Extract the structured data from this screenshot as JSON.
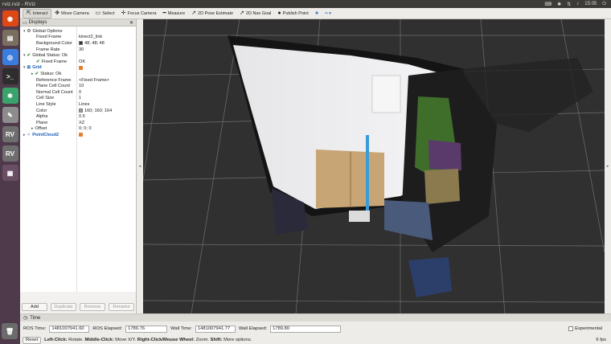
{
  "window": {
    "title": "rviz.rviz - RViz",
    "clock": "15:05"
  },
  "launcher": {
    "items": [
      {
        "name": "ubuntu-dash",
        "glyph": "◉",
        "color": "#dd4814"
      },
      {
        "name": "files",
        "glyph": "▤",
        "color": "#7a6f5f"
      },
      {
        "name": "chrome",
        "glyph": "◎",
        "color": "#3b7ddd"
      },
      {
        "name": "terminal",
        "glyph": ">_",
        "color": "#2d2d2d"
      },
      {
        "name": "robot-app",
        "glyph": "✱",
        "color": "#3aa36b"
      },
      {
        "name": "text-editor",
        "glyph": "✎",
        "color": "#8c8c8c"
      },
      {
        "name": "rviz-1",
        "glyph": "RV",
        "color": "#6e6e6e"
      },
      {
        "name": "rviz-2",
        "glyph": "RV",
        "color": "#6e6e6e"
      },
      {
        "name": "workspace",
        "glyph": "▦",
        "color": "#6a4f64"
      }
    ],
    "trash_glyph": "🗑"
  },
  "toolbar": {
    "tools": [
      {
        "label": "Interact",
        "icon": "cursor-icon",
        "glyph": "⇱",
        "active": true
      },
      {
        "label": "Move Camera",
        "icon": "move-camera-icon",
        "glyph": "✥",
        "active": false
      },
      {
        "label": "Select",
        "icon": "select-icon",
        "glyph": "▭",
        "active": false
      },
      {
        "label": "Focus Camera",
        "icon": "focus-camera-icon",
        "glyph": "✛",
        "active": false
      },
      {
        "label": "Measure",
        "icon": "measure-icon",
        "glyph": "━",
        "active": false
      },
      {
        "label": "2D Pose Estimate",
        "icon": "pose-estimate-icon",
        "glyph": "↗",
        "active": false
      },
      {
        "label": "2D Nav Goal",
        "icon": "nav-goal-icon",
        "glyph": "↗",
        "active": false
      },
      {
        "label": "Publish Point",
        "icon": "publish-point-icon",
        "glyph": "●",
        "active": false
      }
    ]
  },
  "displays": {
    "title": "Displays",
    "rows": [
      {
        "indent": 0,
        "name": "Global Options",
        "value": "",
        "arrow": "▾",
        "icon": "gear",
        "style": ""
      },
      {
        "indent": 1,
        "name": "Fixed Frame",
        "value": "kinect2_link",
        "style": ""
      },
      {
        "indent": 1,
        "name": "Background Color",
        "value": "48; 48; 48",
        "swatch": "#303030",
        "style": ""
      },
      {
        "indent": 1,
        "name": "Frame Rate",
        "value": "30",
        "style": ""
      },
      {
        "indent": 0,
        "name": "Global Status: Ok",
        "value": "",
        "arrow": "▾",
        "icon": "check",
        "style": ""
      },
      {
        "indent": 1,
        "name": "Fixed Frame",
        "value": "OK",
        "icon": "check",
        "style": ""
      },
      {
        "indent": 0,
        "name": "Grid",
        "value": "",
        "arrow": "▾",
        "icon": "grid",
        "style": "blue",
        "checkbox": true
      },
      {
        "indent": 1,
        "name": "Status: Ok",
        "value": "",
        "arrow": "▸",
        "icon": "check",
        "style": ""
      },
      {
        "indent": 1,
        "name": "Reference Frame",
        "value": "<Fixed Frame>",
        "style": ""
      },
      {
        "indent": 1,
        "name": "Plane Cell Count",
        "value": "10",
        "style": ""
      },
      {
        "indent": 1,
        "name": "Normal Cell Count",
        "value": "0",
        "style": ""
      },
      {
        "indent": 1,
        "name": "Cell Size",
        "value": "1",
        "style": ""
      },
      {
        "indent": 1,
        "name": "Line Style",
        "value": "Lines",
        "style": ""
      },
      {
        "indent": 1,
        "name": "Color",
        "value": "160; 160; 164",
        "swatch": "#a0a0a4",
        "style": ""
      },
      {
        "indent": 1,
        "name": "Alpha",
        "value": "0.5",
        "style": ""
      },
      {
        "indent": 1,
        "name": "Plane",
        "value": "XZ",
        "style": ""
      },
      {
        "indent": 1,
        "name": "Offset",
        "value": "0; 0; 0",
        "arrow": "▸",
        "style": ""
      },
      {
        "indent": 0,
        "name": "PointCloud2",
        "value": "",
        "arrow": "▸",
        "icon": "cloud",
        "style": "blue",
        "checkbox": true
      }
    ],
    "buttons": [
      {
        "label": "Add",
        "enabled": true
      },
      {
        "label": "Duplicate",
        "enabled": false
      },
      {
        "label": "Remove",
        "enabled": false
      },
      {
        "label": "Rename",
        "enabled": false
      }
    ]
  },
  "time": {
    "title": "Time",
    "ros_time_label": "ROS Time:",
    "ros_time": "1481007941.60",
    "ros_elapsed_label": "ROS Elapsed:",
    "ros_elapsed": "1789.76",
    "wall_time_label": "Wall Time:",
    "wall_time": "1481007941.77",
    "wall_elapsed_label": "Wall Elapsed:",
    "wall_elapsed": "1789.80",
    "experimental_label": "Experimental"
  },
  "status": {
    "reset_label": "Reset",
    "left_click_key": "Left-Click:",
    "left_click_text": "Rotate.",
    "middle_click_key": "Middle-Click:",
    "middle_click_text": "Move X/Y.",
    "right_click_key": "Right-Click/Mouse Wheel:",
    "right_click_text": "Zoom.",
    "shift_key": "Shift:",
    "shift_text": "More options.",
    "fps": "6 fps"
  }
}
